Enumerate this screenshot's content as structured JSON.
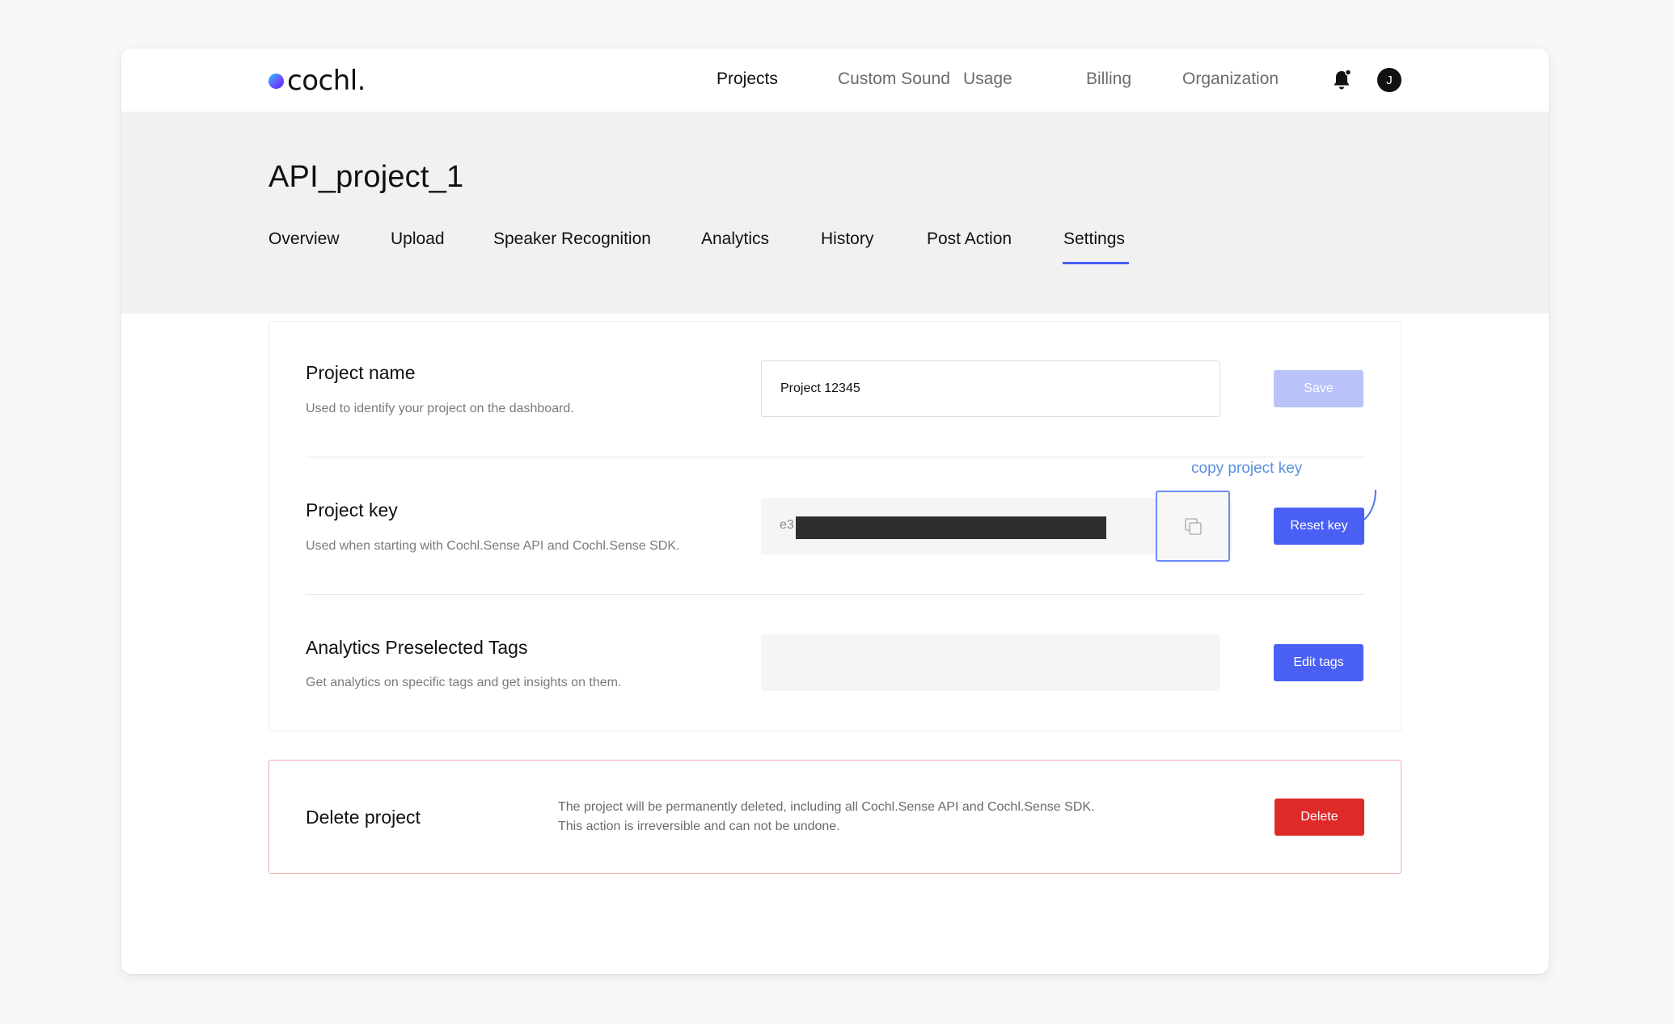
{
  "brand": {
    "name": "cochl."
  },
  "nav": {
    "items": [
      "Projects",
      "Custom Sound",
      "Usage",
      "Billing",
      "Organization"
    ],
    "active": "Projects",
    "avatar_initial": "J"
  },
  "project": {
    "title": "API_project_1",
    "tabs": [
      "Overview",
      "Upload",
      "Speaker Recognition",
      "Analytics",
      "History",
      "Post Action",
      "Settings"
    ],
    "active_tab": "Settings"
  },
  "settings": {
    "name": {
      "title": "Project name",
      "description": "Used to identify your project on the dashboard.",
      "value": "Project 12345",
      "save_label": "Save"
    },
    "key": {
      "title": "Project key",
      "description": "Used when starting with Cochl.Sense API and Cochl.Sense SDK.",
      "prefix": "e3",
      "reset_label": "Reset key",
      "copy_annotation": "copy project key"
    },
    "tags": {
      "title": "Analytics Preselected Tags",
      "description": "Get analytics on specific tags and get insights on them.",
      "edit_label": "Edit tags"
    }
  },
  "delete": {
    "title": "Delete project",
    "description_line1": "The project will be permanently deleted, including all Cochl.Sense API and Cochl.Sense SDK.",
    "description_line2": "This action is irreversible and can not be undone.",
    "button_label": "Delete"
  },
  "icons": {
    "bell": "bell-icon",
    "copy": "copy-icon"
  },
  "colors": {
    "accent": "#4a60f5",
    "accent_disabled": "#b9c3fa",
    "danger": "#e02a2a",
    "annotation": "#5b8fe0"
  }
}
